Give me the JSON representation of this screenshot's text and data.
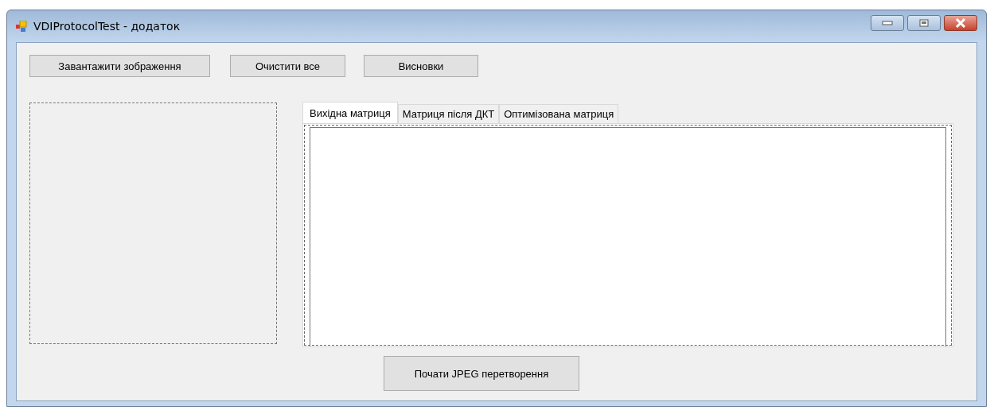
{
  "window": {
    "title": "VDIProtocolTest - додаток"
  },
  "toolbar_buttons": [
    "Завантажити зображення",
    "Очистити все",
    "Висновки"
  ],
  "tabs": [
    {
      "label": "Вихідна матриця",
      "selected": true
    },
    {
      "label": "Матриця після ДКТ",
      "selected": false
    },
    {
      "label": "Оптимізована матриця",
      "selected": false
    }
  ],
  "start_button": "Почати JPEG перетворення"
}
